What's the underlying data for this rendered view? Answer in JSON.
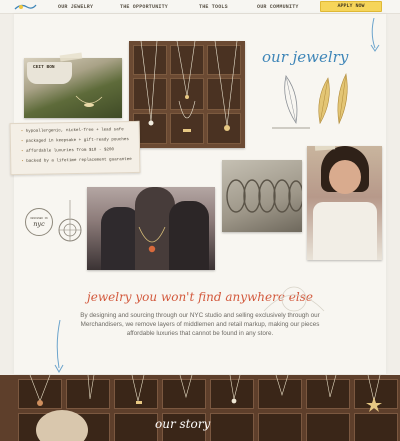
{
  "nav": {
    "items": [
      "OUR JEWELRY",
      "THE OPPORTUNITY",
      "THE TOOLS",
      "OUR COMMUNITY"
    ],
    "apply_label": "APPLY NOW"
  },
  "hero": {
    "bowl_label": "CEIT BON",
    "heading": "our jewelry"
  },
  "features": [
    "hypoallergenic, nickel-free + lead safe",
    "packaged in keepsake + gift-ready pouches",
    "affordable luxuries from $18 - $200",
    "backed by a lifetime replacement guarantee"
  ],
  "badge": {
    "top": "DESIGNED IN",
    "city": "nyc"
  },
  "tagline": "jewelry you won't find anywhere else",
  "description": "By designing and sourcing through our NYC studio and selling exclusively through our Merchandisers, we remove layers of middlemen and retail markup, making our pieces affordable luxuries that cannot be found in any store.",
  "story": {
    "title": "our story"
  },
  "colors": {
    "accent_blue": "#3f86b8",
    "accent_red": "#d35a3e",
    "apply_bg": "#f6d55a",
    "wood": "#5e3f2b"
  },
  "icons": [
    "logo-icon",
    "arrow-down-icon",
    "feather-earring-icon",
    "necklace-icon",
    "compass-icon"
  ]
}
